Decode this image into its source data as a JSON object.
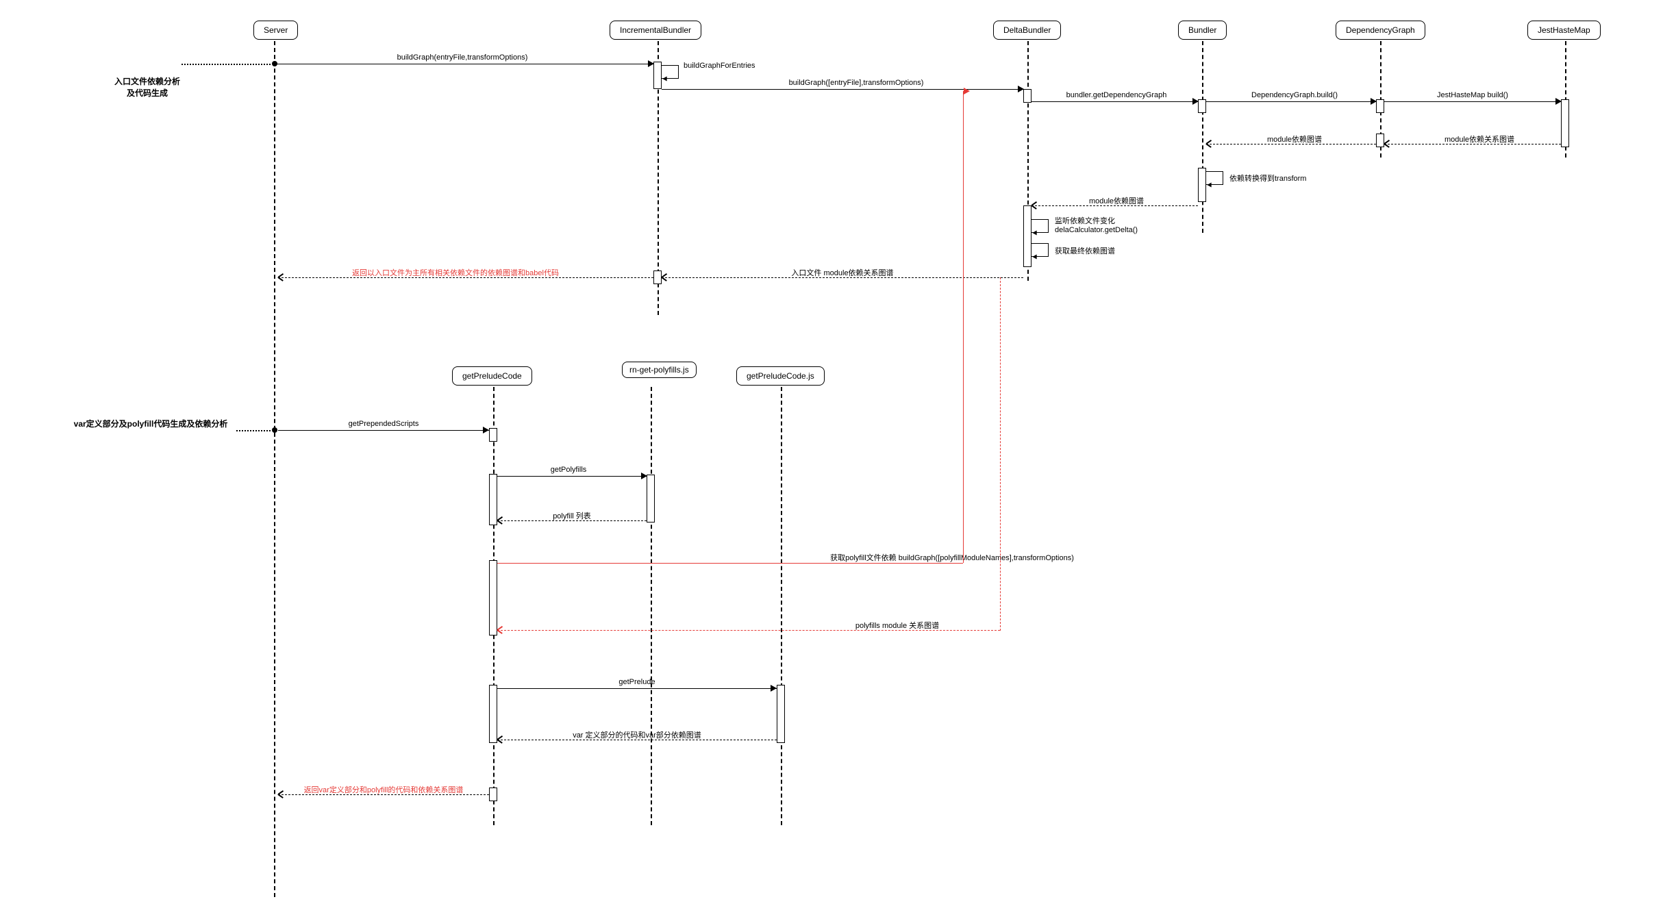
{
  "participants": {
    "server": "Server",
    "incBundler": "IncrementalBundler",
    "deltaBundler": "DeltaBundler",
    "bundler": "Bundler",
    "depGraph": "DependencyGraph",
    "jestHaste": "JestHasteMap",
    "getPreludeCode": "getPreludeCode",
    "rnGetPolyfills": "rn-get-polyfills.js",
    "getPreludeCodeJs": "getPreludeCode.js"
  },
  "sections": {
    "section1": "入口文件依赖分析及代码生成",
    "section2": "var定义部分及polyfill代码生成及依赖分析"
  },
  "messages": {
    "buildGraph1": "buildGraph(entryFile,transformOptions)",
    "buildGraphForEntries": "buildGraphForEntries",
    "buildGraph2": "buildGraph([entryFile],transformOptions)",
    "getDepGraph": "bundler.getDependencyGraph",
    "depGraphBuild": "DependencyGraph.build()",
    "jestHasteBuild": "JestHasteMap  build()",
    "moduleDepRel": "module依赖关系图谱",
    "moduleDep": "module依赖图谱",
    "depTransform": "依赖转换得到transform",
    "moduleDep2": "module依赖图谱",
    "listenDep": "监听依赖文件变化",
    "delaCalc": "delaCalculator.getDelta()",
    "getFinalDep": "获取最终依赖图谱",
    "entryModuleDep": "入口文件 module依赖关系图谱",
    "returnEntry": "返回以入口文件为主所有相关依赖文件的依赖图谱和babel代码",
    "getPrependedScripts": "getPrependedScripts",
    "getPolyfills": "getPolyfills",
    "polyfillList": "polyfill 列表",
    "getPolyfillDep": "获取polyfill文件依赖 buildGraph([polyfillModuleNames],transformOptions)",
    "polyfillsModule": "polyfills  module  关系图谱",
    "getPrelude": "getPrelude",
    "varDefCode": "var 定义部分的代码和var部分依赖图谱",
    "returnVar": "返回var定义部分和polyfill的代码和依赖关系图谱"
  }
}
